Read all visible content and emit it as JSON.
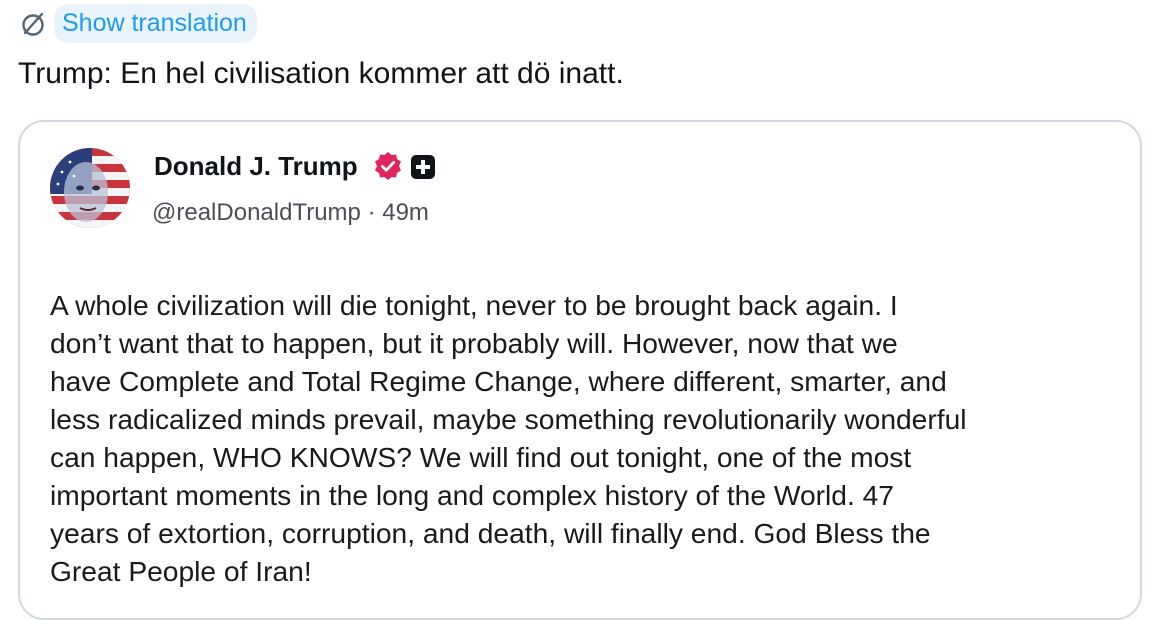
{
  "translate": {
    "label": "Show translation",
    "icon": "translate-globe-icon"
  },
  "tweet": {
    "text": "Trump: En hel civilisation kommer att dö inatt."
  },
  "quote": {
    "author_name": "Donald J. Trump",
    "verified_icon": "verified-badge-icon",
    "verified_color": "#e0245e",
    "plus_icon": "plus-icon",
    "handle": "@realDonaldTrump",
    "separator": "·",
    "time": "49m",
    "body": "A whole civilization will die tonight, never to be brought back again. I\ndon’t want that to happen, but it probably will. However, now that we\nhave Complete and Total Regime Change, where different, smarter, and\nless radicalized minds prevail, maybe something revolutionarily wonderful\ncan happen, WHO KNOWS? We will find out tonight, one of the most\nimportant moments in the long and complex history of the World. 47\nyears of extortion, corruption, and death, will finally end. God Bless the\nGreat People of Iran!"
  },
  "colors": {
    "link_blue": "#1d9bf0",
    "translate_bg": "#e8f3fc",
    "card_border": "#cfd9de"
  }
}
